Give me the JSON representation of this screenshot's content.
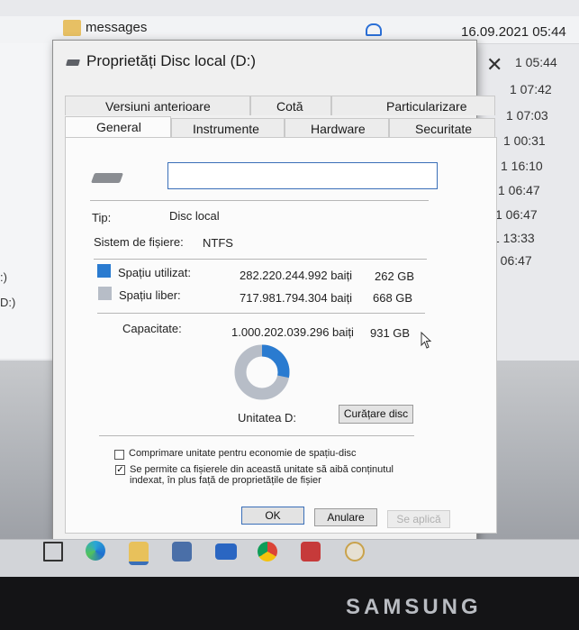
{
  "explorer": {
    "folder_name": "messages",
    "top_date": "16.09.2021 05:44",
    "side_dates": [
      "1 05:44",
      "1 07:42",
      "1 07:03",
      "1 00:31",
      "1 16:10",
      "1 06:47",
      "1 06:47",
      "1 13:33",
      "1 06:47"
    ],
    "left_drives": [
      ":)",
      "D:)"
    ]
  },
  "dialog": {
    "title": "Proprietăți Disc local (D:)",
    "close_symbol": "✕",
    "tabs_row1": [
      "Versiuni anterioare",
      "Cotă",
      "Particularizare"
    ],
    "tabs_row2": [
      "General",
      "Instrumente",
      "Hardware",
      "Securitate"
    ],
    "active_tab": "General",
    "name_value": "",
    "type_label": "Tip:",
    "type_value": "Disc local",
    "fs_label": "Sistem de fișiere:",
    "fs_value": "NTFS",
    "used": {
      "label": "Spațiu utilizat:",
      "bytes": "282.220.244.992 baiți",
      "size": "262 GB",
      "color": "#2a7bd0"
    },
    "free": {
      "label": "Spațiu liber:",
      "bytes": "717.981.794.304 baiți",
      "size": "668 GB",
      "color": "#b7bdc7"
    },
    "capacity": {
      "label": "Capacitate:",
      "bytes": "1.000.202.039.296 baiți",
      "size": "931 GB"
    },
    "used_fraction": 0.282,
    "drive_label": "Unitatea D:",
    "cleanup_button": "Curățare disc",
    "compress_label": "Comprimare unitate pentru economie de spațiu-disc",
    "compress_checked": false,
    "index_label_line1": "Se permite ca fișierele din această unitate să aibă conținutul",
    "index_label_line2": "indexat, în plus față de proprietățile de fișier",
    "index_checked": true,
    "ok_button": "OK",
    "cancel_button": "Anulare",
    "apply_button": "Se aplică"
  },
  "brand": "SAMSUNG"
}
